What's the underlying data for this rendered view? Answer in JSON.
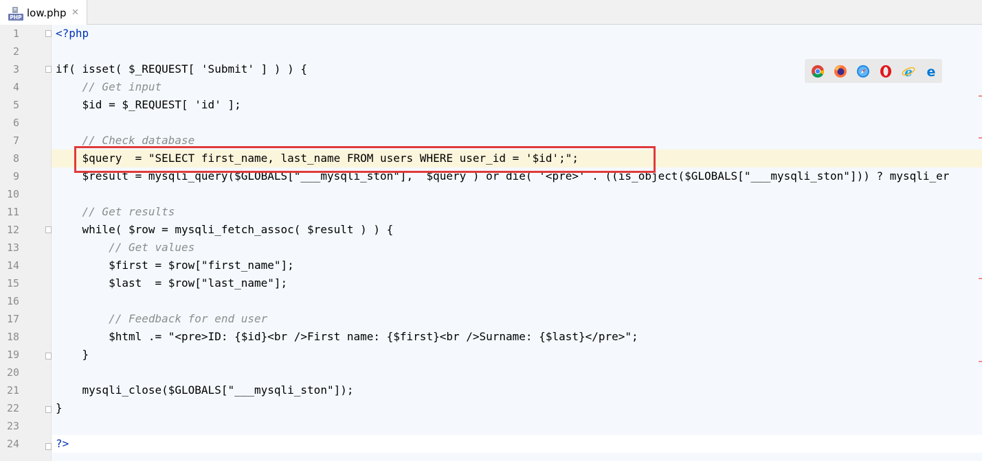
{
  "tab": {
    "filename": "low.php",
    "close_glyph": "✕"
  },
  "editor": {
    "lines": [
      {
        "n": "1",
        "text": "<?php"
      },
      {
        "n": "2",
        "text": ""
      },
      {
        "n": "3",
        "text": "if( isset( $_REQUEST[ 'Submit' ] ) ) {"
      },
      {
        "n": "4",
        "text": "    // Get input"
      },
      {
        "n": "5",
        "text": "    $id = $_REQUEST[ 'id' ];"
      },
      {
        "n": "6",
        "text": ""
      },
      {
        "n": "7",
        "text": "    // Check database"
      },
      {
        "n": "8",
        "text": "    $query  = \"SELECT first_name, last_name FROM users WHERE user_id = '$id';\";"
      },
      {
        "n": "9",
        "text": "    $result = mysqli_query($GLOBALS[\"___mysqli_ston\"],  $query ) or die( '<pre>' . ((is_object($GLOBALS[\"___mysqli_ston\"])) ? mysqli_er"
      },
      {
        "n": "10",
        "text": ""
      },
      {
        "n": "11",
        "text": "    // Get results"
      },
      {
        "n": "12",
        "text": "    while( $row = mysqli_fetch_assoc( $result ) ) {"
      },
      {
        "n": "13",
        "text": "        // Get values"
      },
      {
        "n": "14",
        "text": "        $first = $row[\"first_name\"];"
      },
      {
        "n": "15",
        "text": "        $last  = $row[\"last_name\"];"
      },
      {
        "n": "16",
        "text": ""
      },
      {
        "n": "17",
        "text": "        // Feedback for end user"
      },
      {
        "n": "18",
        "text": "        $html .= \"<pre>ID: {$id}<br />First name: {$first}<br />Surname: {$last}</pre>\";"
      },
      {
        "n": "19",
        "text": "    }"
      },
      {
        "n": "20",
        "text": ""
      },
      {
        "n": "21",
        "text": "    mysqli_close($GLOBALS[\"___mysqli_ston\"]);"
      },
      {
        "n": "22",
        "text": "}"
      },
      {
        "n": "23",
        "text": ""
      },
      {
        "n": "24",
        "text": "?>"
      }
    ],
    "current_line": "8"
  },
  "browsers": [
    "chrome-icon",
    "firefox-icon",
    "safari-icon",
    "opera-icon",
    "ie-icon",
    "edge-icon"
  ],
  "colors": {
    "keyword": "#0033b3",
    "variable": "#871094",
    "string": "#067d17",
    "comment": "#8c8c8c",
    "highlight_box": "#e03a3a"
  }
}
